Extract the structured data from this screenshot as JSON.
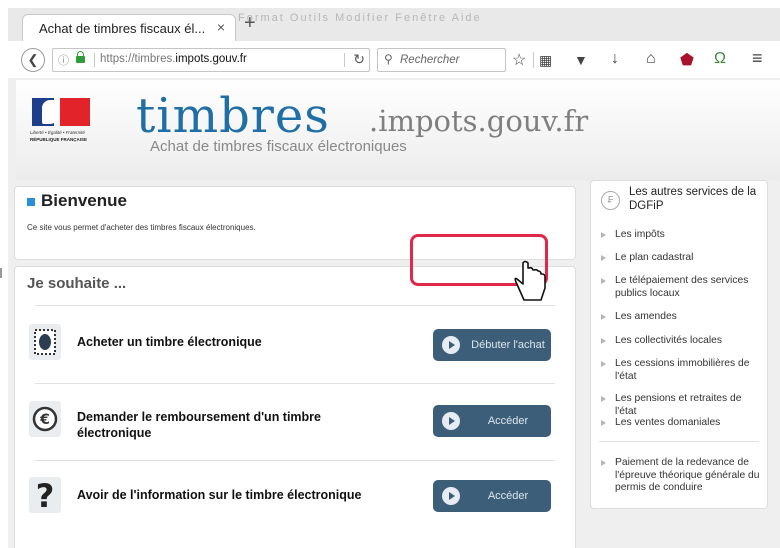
{
  "browser": {
    "tab_title": "Achat de timbres fiscaux él...",
    "tab_close": "×",
    "new_tab": "+",
    "menubar_ghost": "Format   Outils   Modifier   Fenêtre   Aide",
    "url_prefix": "https://timbres.",
    "url_domain": "impots.gouv.fr",
    "search_placeholder": "Rechercher",
    "toolbar_icons": [
      "bookmark-star-icon",
      "reading-list-icon",
      "pocket-icon",
      "download-icon",
      "home-icon",
      "ublock-icon",
      "extension-icon",
      "menu-icon"
    ]
  },
  "banner": {
    "flag_line1": "Liberté • Égalité • Fraternité",
    "flag_line2": "RÉPUBLIQUE FRANÇAISE",
    "site_name": "timbres",
    "site_domain": ".impots.gouv.fr",
    "subtitle": "Achat de timbres fiscaux électroniques"
  },
  "welcome": {
    "title": "Bienvenue",
    "text": "Ce site vous permet d'acheter des timbres fiscaux électroniques."
  },
  "wish": {
    "heading": "Je souhaite ...",
    "rows": [
      {
        "label": "Acheter un timbre électronique",
        "button": "Débuter l'achat",
        "icon": "stamp-icon"
      },
      {
        "label": "Demander le remboursement d'un timbre électronique",
        "button": "Accéder",
        "icon": "euro-icon"
      },
      {
        "label": "Avoir de l'information sur le timbre électronique",
        "button": "Accéder",
        "icon": "question-icon"
      }
    ]
  },
  "sidebar": {
    "title": "Les autres services de la DGFiP",
    "items": [
      "Les impôts",
      "Le plan cadastral",
      "Le télépaiement des services publics locaux",
      "Les amendes",
      "Les collectivités locales",
      "Les cessions immobilières de l'état",
      "Les pensions et retraites de l'état",
      "Les ventes domaniales",
      "Paiement de la redevance de l'épreuve théorique générale du permis de conduire"
    ]
  },
  "colors": {
    "accent": "#1f6fa6",
    "button": "#3c5e78",
    "highlight": "#e0294a"
  }
}
